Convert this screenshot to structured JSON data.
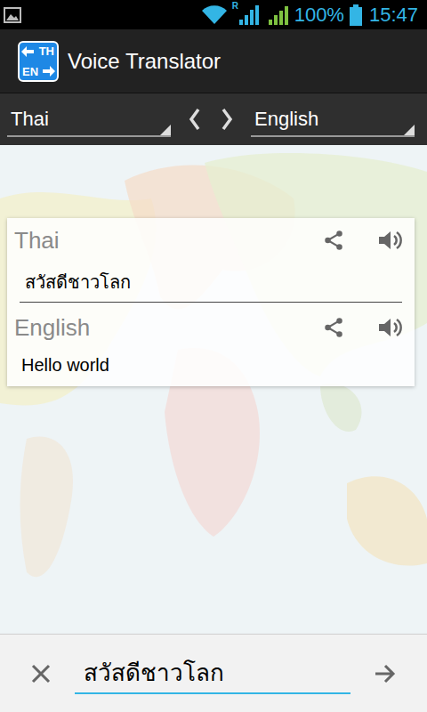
{
  "status_bar": {
    "roaming": "R",
    "battery": "100%",
    "time": "15:47"
  },
  "app_bar": {
    "title": "Voice Translator",
    "logo": {
      "top": "TH",
      "bottom": "EN"
    }
  },
  "language_bar": {
    "source": "Thai",
    "target": "English"
  },
  "result": [
    {
      "language": "Thai",
      "text": "สวัสดีชาวโลก"
    },
    {
      "language": "English",
      "text": "Hello world"
    }
  ],
  "input": {
    "value": "สวัสดีชาวโลก"
  }
}
